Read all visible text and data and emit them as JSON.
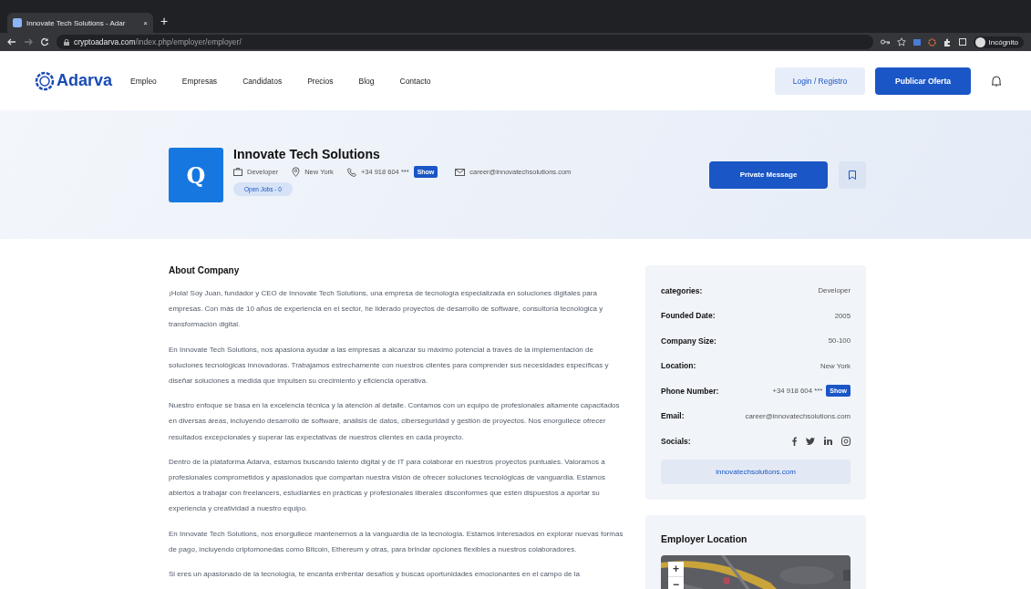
{
  "browser": {
    "tab_title": "Innovate Tech Solutions - Adar",
    "tab_close": "×",
    "new_tab": "+",
    "url_host": "cryptoadarva.com",
    "url_path": "/index.php/employer/employer/",
    "profile": "Incógnito"
  },
  "nav": {
    "logo": "Adarva",
    "items": [
      "Empleo",
      "Empresas",
      "Candidatos",
      "Precios",
      "Blog",
      "Contacto"
    ],
    "login": "Login / Registro",
    "post": "Publicar Oferta"
  },
  "header": {
    "logo_letter": "Q",
    "name": "Innovate Tech Solutions",
    "category": "Developer",
    "location": "New York",
    "phone": "+34 918 604 ***",
    "show": "Show",
    "email": "career@innovatechsolutions.com",
    "open_jobs": "Open Jobs - 0",
    "message": "Private Message"
  },
  "about": {
    "title": "About Company",
    "paragraphs": [
      "¡Hola! Soy Juan, fundador y CEO de Innovate Tech Solutions, una empresa de tecnología especializada en soluciones digitales para empresas. Con más de 10 años de experiencia en el sector, he liderado proyectos de desarrollo de software, consultoría tecnológica y transformación digital.",
      "En Innovate Tech Solutions, nos apasiona ayudar a las empresas a alcanzar su máximo potencial a través de la implementación de soluciones tecnológicas innovadoras. Trabajamos estrechamente con nuestros clientes para comprender sus necesidades específicas y diseñar soluciones a medida que impulsen su crecimiento y eficiencia operativa.",
      "Nuestro enfoque se basa en la excelencia técnica y la atención al detalle. Contamos con un equipo de profesionales altamente capacitados en diversas áreas, incluyendo desarrollo de software, análisis de datos, ciberseguridad y gestión de proyectos. Nos enorgullece ofrecer resultados excepcionales y superar las expectativas de nuestros clientes en cada proyecto.",
      "Dentro de la plataforma Adarva, estamos buscando talento digital y de IT para colaborar en nuestros proyectos puntuales. Valoramos a profesionales comprometidos y apasionados que compartan nuestra visión de ofrecer soluciones tecnológicas de vanguardia. Estamos abiertos a trabajar con freelancers, estudiantes en prácticas y profesionales liberales disconformes que estén dispuestos a aportar su experiencia y creatividad a nuestro equipo.",
      "En Innovate Tech Solutions, nos enorgullece mantenernos a la vanguardia de la tecnología. Estamos interesados en explorar nuevas formas de pago, incluyendo criptomonedas como Bitcoin, Ethereum y otras, para brindar opciones flexibles a nuestros colaboradores.",
      "Si eres un apasionado de la tecnología, te encanta enfrentar desafíos y buscas oportunidades emocionantes en el campo de la"
    ]
  },
  "details": {
    "rows": [
      {
        "kind": "text",
        "label": "categories:",
        "value": "Developer"
      },
      {
        "kind": "text",
        "label": "Founded Date:",
        "value": "2005"
      },
      {
        "kind": "text",
        "label": "Company Size:",
        "value": "50-100"
      },
      {
        "kind": "text",
        "label": "Location:",
        "value": "New York"
      },
      {
        "kind": "phone",
        "label": "Phone Number:",
        "value": "+34 918 604 ***",
        "button": "Show"
      },
      {
        "kind": "text",
        "label": "Email:",
        "value": "career@innovatechsolutions.com"
      },
      {
        "kind": "socials",
        "label": "Socials:"
      }
    ],
    "website": "innovatechsolutions.com"
  },
  "location": {
    "title": "Employer Location",
    "zoom_in": "+",
    "zoom_out": "−"
  }
}
